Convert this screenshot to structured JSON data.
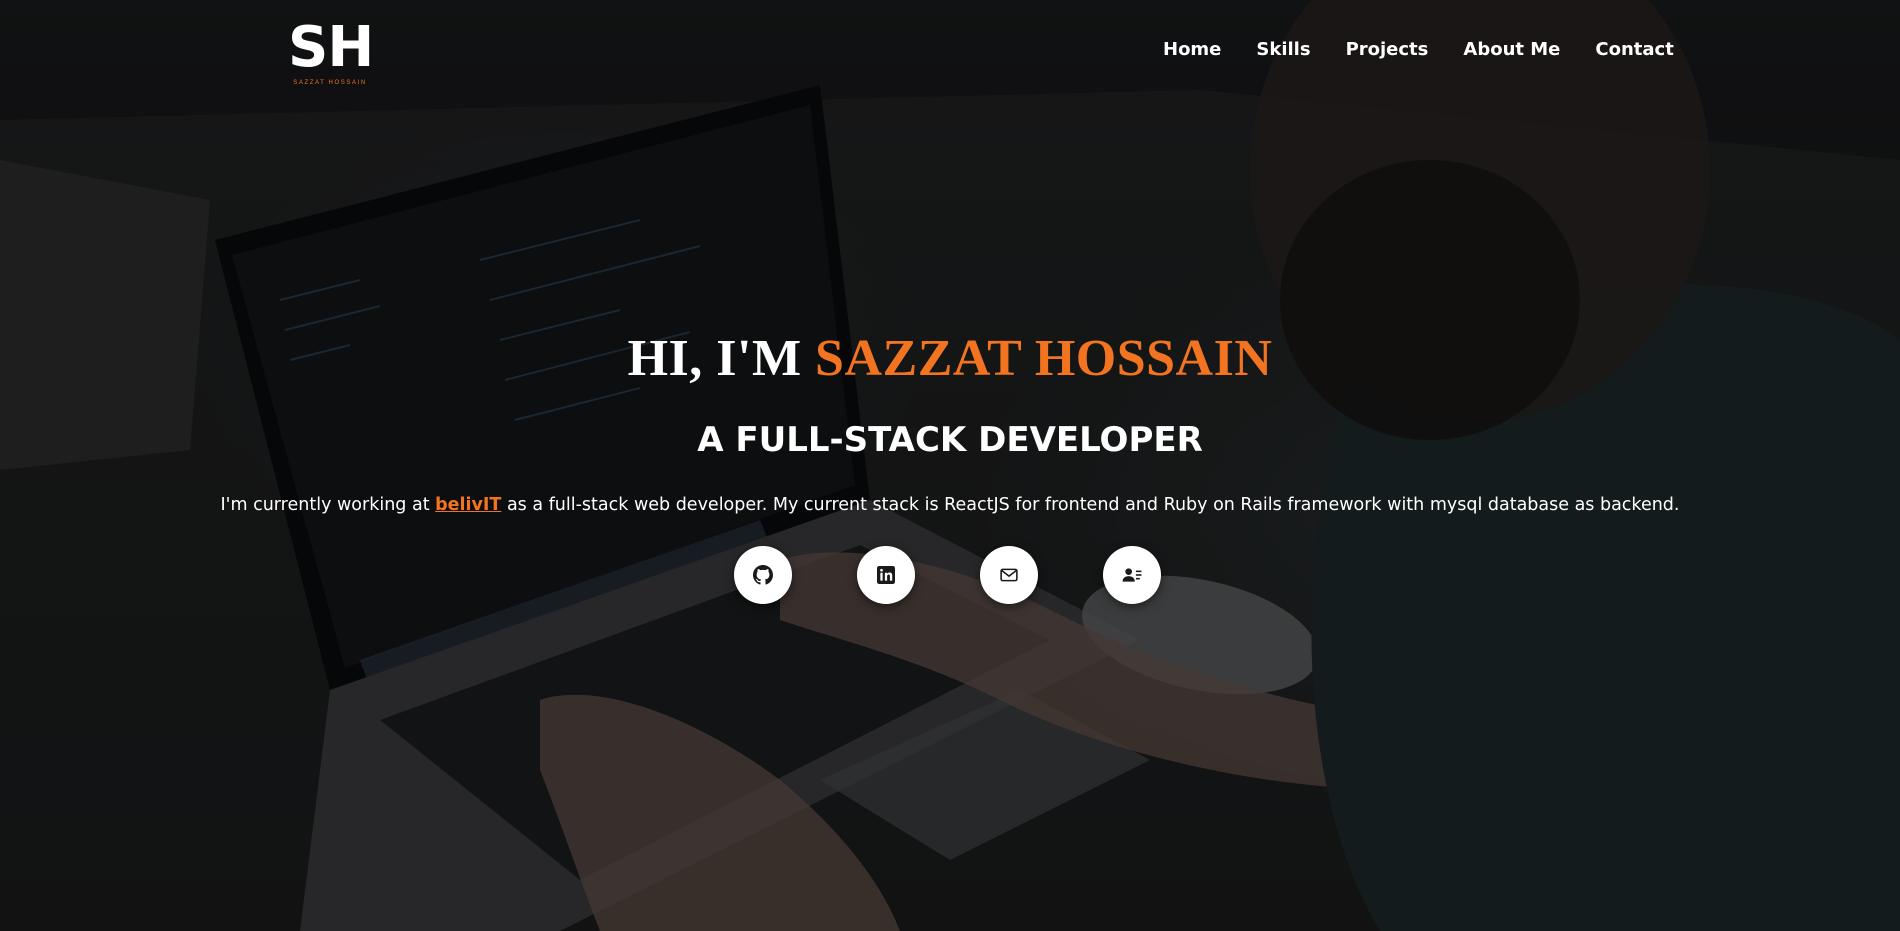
{
  "logo": {
    "mark": "SH",
    "subtitle": "SAZZAT HOSSAIN"
  },
  "nav": {
    "items": [
      {
        "label": "Home"
      },
      {
        "label": "Skills"
      },
      {
        "label": "Projects"
      },
      {
        "label": "About Me"
      },
      {
        "label": "Contact"
      }
    ]
  },
  "hero": {
    "title_prefix": "HI, I'M ",
    "title_name": "SAZZAT HOSSAIN",
    "subtitle": "A FULL-STACK DEVELOPER",
    "bio_before": "I'm currently working at ",
    "bio_link": "belivIT",
    "bio_after": " as a full-stack web developer. My current stack is ReactJS for frontend and Ruby on Rails framework with mysql database as backend."
  },
  "socials": [
    {
      "icon": "github-icon"
    },
    {
      "icon": "linkedin-icon"
    },
    {
      "icon": "mail-icon"
    },
    {
      "icon": "contact-card-icon"
    }
  ],
  "colors": {
    "accent": "#f27420",
    "text": "#ffffff",
    "button_bg": "#ffffff",
    "icon": "#1a1a1a"
  }
}
